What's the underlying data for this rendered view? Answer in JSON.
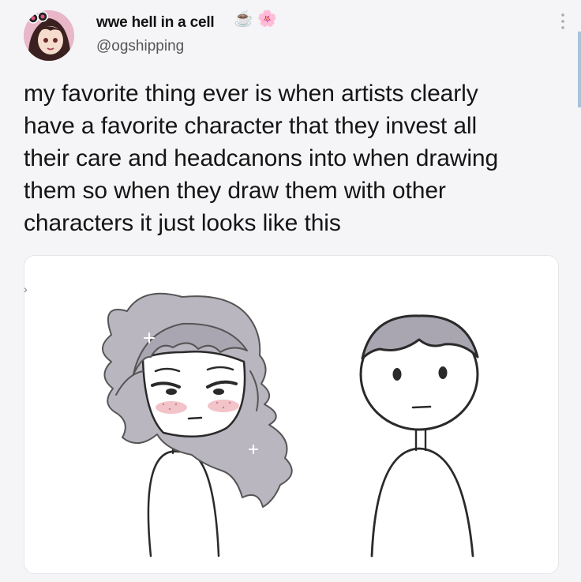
{
  "tweet": {
    "author_name": "wwe hell in a cell",
    "name_emoji": [
      "☕",
      "🌸"
    ],
    "handle": "@ogshipping",
    "text": "my favorite thing ever is when artists clearly\nhave a favorite character that they invest all\ntheir care and headcanons into when drawing\nthem so when they draw them with other\ncharacters it just looks like this"
  },
  "icons": {
    "more": "more-options-icon",
    "left_arrow": "chevron-right-icon"
  },
  "colors": {
    "page_bg": "#f5f4f6",
    "media_bg": "#ffffff",
    "blush": "#f0b8bf",
    "scroll_accent": "#a9c3db"
  }
}
